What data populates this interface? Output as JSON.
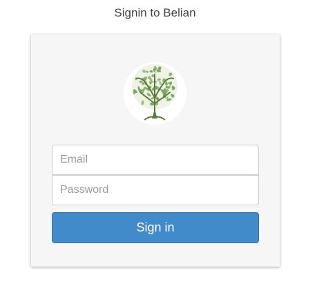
{
  "page": {
    "title": "Signin to Belian"
  },
  "form": {
    "email_placeholder": "Email",
    "password_placeholder": "Password",
    "email_value": "",
    "password_value": "",
    "submit_label": "Sign in"
  },
  "logo": {
    "icon": "tree-icon",
    "leaf_color": "#7aa35c",
    "trunk_color": "#5a7a3a"
  },
  "colors": {
    "button": "#428bca",
    "card": "#f6f6f6"
  }
}
